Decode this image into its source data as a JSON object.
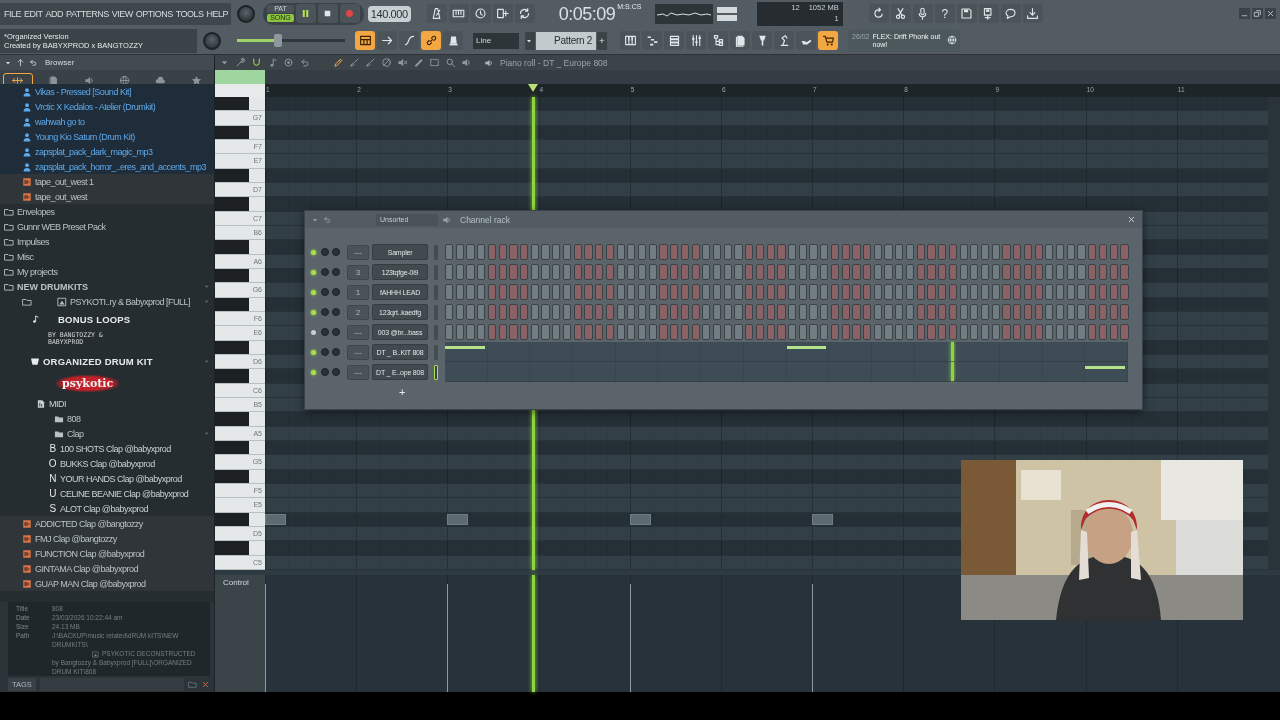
{
  "menu": [
    "FILE",
    "EDIT",
    "ADD",
    "PATTERNS",
    "VIEW",
    "OPTIONS",
    "TOOLS",
    "HELP"
  ],
  "hint_bar": {
    "lines": [
      "*Organized Version",
      "Created by BABYXPROD x BANGTOZZY"
    ]
  },
  "transport": {
    "mode": [
      {
        "label": "PAT",
        "selected": false
      },
      {
        "label": "SONG",
        "selected": true
      }
    ],
    "playing": true,
    "tempo": "140.000"
  },
  "time": {
    "value": "0:05:09",
    "unit": "M:S:CS"
  },
  "master_volume": {
    "level": 0.38
  },
  "cpu_panel": {
    "count": "12",
    "memory": "1052 MB",
    "voices": "1"
  },
  "toolbar_top": [
    {
      "on": false
    },
    {
      "on": false
    },
    {
      "on": false
    },
    {
      "on": false
    },
    {
      "on": false
    }
  ],
  "toolbar_right": [
    {
      "on": false
    },
    {
      "on": false
    },
    {
      "on": false
    },
    {
      "on": false,
      "glyph": "?"
    },
    {
      "on": false
    },
    {
      "on": false
    },
    {
      "on": false
    },
    {
      "on": false
    }
  ],
  "toolbar_second": [
    {
      "on": true
    },
    {
      "on": false
    },
    {
      "on": false
    },
    {
      "on": true
    },
    {
      "on": false
    }
  ],
  "snap": {
    "value": "Line"
  },
  "pattern": {
    "value": "Pattern 2",
    "add": "+"
  },
  "toolbar_windows": [
    {
      "on": false
    },
    {
      "on": false
    },
    {
      "on": false
    },
    {
      "on": false
    },
    {
      "on": false
    },
    {
      "on": false
    },
    {
      "on": false
    },
    {
      "on": false
    },
    {
      "on": false
    },
    {
      "on": true
    }
  ],
  "news": {
    "date": "26/02",
    "text": "FLEX: Drift Phonk out now!"
  },
  "browser": {
    "title": "Browser",
    "tabs": [
      {
        "selected": true
      },
      {
        "selected": false
      },
      {
        "selected": false
      },
      {
        "selected": false
      },
      {
        "selected": false
      },
      {
        "selected": false
      }
    ],
    "tree": [
      {
        "kind": "pack",
        "label": "Vikas - Pressed [Sound Kit]"
      },
      {
        "kind": "pack",
        "label": "Vrctic X Kedalos - Atelier (Drumkit)"
      },
      {
        "kind": "pack",
        "label": "wahwah go to"
      },
      {
        "kind": "pack",
        "label": "Young Kio Saturn (Drum Kit)"
      },
      {
        "kind": "pack",
        "label": "zapsplat_pack_dark_magic_mp3"
      },
      {
        "kind": "pack",
        "label": "zapsplat_pack_horror_..eres_and_accents_mp3"
      },
      {
        "kind": "audio",
        "label": "tape_out_west 1"
      },
      {
        "kind": "audio",
        "label": "tape_out_west"
      },
      {
        "kind": "folder",
        "label": "Envelopes",
        "expanded": false
      },
      {
        "kind": "folder",
        "label": "Gunnr WEB Preset Pack",
        "expanded": false
      },
      {
        "kind": "folder",
        "label": "Impulses",
        "expanded": false
      },
      {
        "kind": "folder",
        "label": "Misc",
        "expanded": false
      },
      {
        "kind": "folder",
        "label": "My projects",
        "expanded": false
      },
      {
        "kind": "folder",
        "label": "NEW DRUMKITS",
        "expanded": true,
        "children": [
          {
            "kind": "pack_folder",
            "label": "PSYKOTI..ry & Babyxprod [FULL]",
            "expanded": true,
            "children": [
              {
                "kind": "banner",
                "label": "BONUS LOOPS",
                "caption": "BY BANGTOZZY & BABYXPROD"
              },
              {
                "kind": "banner",
                "label": "ORGANIZED DRUM KIT",
                "expanded": true,
                "children": [
                  {
                    "kind": "logo",
                    "label": "psykotic"
                  },
                  {
                    "kind": "midi",
                    "label": "MIDI"
                  },
                  {
                    "kind": "folder",
                    "label": "808",
                    "expanded": false
                  },
                  {
                    "kind": "folder",
                    "label": "Clap",
                    "expanded": true,
                    "children": [
                      {
                        "kind": "letter",
                        "mark": "B",
                        "label": "100 SHOTS Clap @babyxprod"
                      },
                      {
                        "kind": "letter",
                        "mark": "O",
                        "label": "BUKKS Clap @babyxprod"
                      },
                      {
                        "kind": "letter",
                        "mark": "N",
                        "label": "YOUR HANDS Clap @babyxprod"
                      },
                      {
                        "kind": "letter",
                        "mark": "U",
                        "label": "CELINE BEANIE Clap @babyxprod"
                      },
                      {
                        "kind": "letter",
                        "mark": "S",
                        "label": "ALOT Clap @babyxprod"
                      },
                      {
                        "kind": "audio",
                        "label": "ADDICTED Clap @bangtozzy"
                      },
                      {
                        "kind": "audio",
                        "label": "FMJ Clap @bangtozzy"
                      },
                      {
                        "kind": "audio",
                        "label": "FUNCTION Clap @babyxprod"
                      },
                      {
                        "kind": "audio",
                        "label": "GINTAMA Clap @babyxprod"
                      },
                      {
                        "kind": "audio",
                        "label": "GUAP MAN Clap @babyxprod"
                      }
                    ]
                  }
                ]
              }
            ]
          }
        ]
      }
    ],
    "info": [
      {
        "label": "Title",
        "value": "808"
      },
      {
        "label": "Date",
        "value": "23/03/2026 10:22:44 am"
      },
      {
        "label": "Size",
        "value": "24.13 MB"
      }
    ],
    "path": {
      "label": "Path",
      "start": "J:\\BACKUP\\music related\\dRUM kITS\\NEW DRUMKITS\\",
      "end": "PSYKOTIC DECONSTRUCTED by Bangtozzy & Babyxprod [FULL]\\ORGANIZED DRUM KIT\\808"
    },
    "tags_label": "TAGS"
  },
  "piano_roll": {
    "title": "Piano roll - DT _ Europe 808",
    "tools": [
      {
        "on": false
      },
      {
        "on": false
      },
      {
        "on": true
      },
      {
        "on": false
      },
      {
        "on": false
      },
      {
        "on": false
      },
      {
        "on": true
      },
      {
        "on": false
      },
      {
        "on": false
      },
      {
        "on": false
      },
      {
        "on": false
      },
      {
        "on": false
      },
      {
        "on": false
      },
      {
        "on": false
      },
      {
        "on": false
      }
    ],
    "ruler": [
      "1",
      "2",
      "3",
      "4",
      "5",
      "6",
      "7",
      "8",
      "9",
      "10",
      "11"
    ],
    "playhead": {
      "level": 0.267
    },
    "keys": [
      {
        "kind": "black"
      },
      {
        "kind": "white",
        "label": "G7"
      },
      {
        "kind": "black"
      },
      {
        "kind": "white",
        "label": "F7"
      },
      {
        "kind": "white",
        "label": "E7"
      },
      {
        "kind": "black"
      },
      {
        "kind": "white",
        "label": "D7"
      },
      {
        "kind": "black"
      },
      {
        "kind": "white",
        "label": "C7"
      },
      {
        "kind": "white",
        "label": "B6"
      },
      {
        "kind": "black"
      },
      {
        "kind": "white",
        "label": "A6"
      },
      {
        "kind": "black"
      },
      {
        "kind": "white",
        "label": "G6"
      },
      {
        "kind": "black"
      },
      {
        "kind": "white",
        "label": "F6"
      },
      {
        "kind": "white",
        "label": "E6"
      },
      {
        "kind": "black"
      },
      {
        "kind": "white",
        "label": "D6"
      },
      {
        "kind": "black"
      },
      {
        "kind": "white",
        "label": "C6"
      },
      {
        "kind": "white",
        "label": "B5"
      },
      {
        "kind": "black"
      },
      {
        "kind": "white",
        "label": "A5"
      },
      {
        "kind": "black"
      },
      {
        "kind": "white",
        "label": "G5"
      },
      {
        "kind": "black"
      },
      {
        "kind": "white",
        "label": "F5"
      },
      {
        "kind": "white",
        "label": "E5"
      },
      {
        "kind": "black",
        "note_in_bar": [
          true,
          false,
          true,
          false,
          true,
          false,
          true,
          false
        ]
      },
      {
        "kind": "white",
        "label": "D5"
      },
      {
        "kind": "black"
      },
      {
        "kind": "white",
        "label": "C5"
      }
    ],
    "control_lane": {
      "label": "Control"
    }
  },
  "channel_rack": {
    "title": "Channel rack",
    "filter": "Unsorted",
    "add": "+",
    "playhead": {
      "level": 0.742
    },
    "channels": [
      {
        "kind": "steps",
        "name": "Sampler",
        "track": "---",
        "on": true,
        "selected": false,
        "steps": [
          false,
          false,
          false,
          false,
          false,
          false,
          false,
          false,
          false,
          false,
          false,
          false,
          false,
          false,
          false,
          false,
          false,
          false,
          false,
          false,
          false,
          false,
          false,
          false,
          false,
          false,
          false,
          false,
          false,
          false,
          false,
          false,
          false,
          false,
          false,
          false,
          false,
          false,
          false,
          false,
          false,
          false,
          false,
          false,
          false,
          false,
          false,
          false,
          false,
          false,
          false,
          false,
          false,
          false,
          false,
          false,
          false,
          false,
          false,
          false,
          false,
          false,
          false,
          false
        ]
      },
      {
        "kind": "steps",
        "name": "123tqfge-0i9",
        "track": "3",
        "on": true,
        "selected": false,
        "steps": [
          false,
          false,
          false,
          false,
          false,
          false,
          false,
          false,
          false,
          false,
          false,
          false,
          false,
          false,
          false,
          false,
          false,
          false,
          false,
          false,
          false,
          false,
          false,
          false,
          false,
          false,
          false,
          false,
          false,
          false,
          false,
          false,
          false,
          false,
          false,
          false,
          false,
          false,
          false,
          false,
          false,
          false,
          false,
          false,
          false,
          false,
          false,
          false,
          false,
          false,
          false,
          false,
          false,
          false,
          false,
          false,
          false,
          false,
          false,
          false,
          false,
          false,
          false,
          false
        ]
      },
      {
        "kind": "steps",
        "name": "fAHHH LEAD",
        "track": "1",
        "on": true,
        "selected": false,
        "steps": [
          false,
          false,
          false,
          false,
          false,
          false,
          false,
          false,
          false,
          false,
          false,
          false,
          false,
          false,
          false,
          false,
          false,
          false,
          false,
          false,
          false,
          false,
          false,
          false,
          false,
          false,
          false,
          false,
          false,
          false,
          false,
          false,
          false,
          false,
          false,
          false,
          false,
          false,
          false,
          false,
          false,
          false,
          false,
          false,
          false,
          false,
          false,
          false,
          false,
          false,
          false,
          false,
          false,
          false,
          false,
          false,
          false,
          false,
          false,
          false,
          false,
          false,
          false,
          false
        ]
      },
      {
        "kind": "steps",
        "name": "123qrt..kaedfg",
        "track": "2",
        "on": true,
        "selected": false,
        "steps": [
          false,
          false,
          false,
          false,
          false,
          false,
          false,
          false,
          false,
          false,
          false,
          false,
          false,
          false,
          false,
          false,
          false,
          false,
          false,
          false,
          false,
          false,
          false,
          false,
          false,
          false,
          false,
          false,
          false,
          false,
          false,
          false,
          false,
          false,
          false,
          false,
          false,
          false,
          false,
          false,
          false,
          false,
          false,
          false,
          false,
          false,
          false,
          false,
          false,
          false,
          false,
          false,
          false,
          false,
          false,
          false,
          false,
          false,
          false,
          false,
          false,
          false,
          false,
          false
        ]
      },
      {
        "kind": "steps",
        "name": "003 @br...bass",
        "track": "---",
        "on": false,
        "selected": false,
        "steps": [
          false,
          false,
          false,
          false,
          false,
          false,
          false,
          false,
          false,
          false,
          false,
          false,
          false,
          false,
          false,
          false,
          false,
          false,
          false,
          false,
          false,
          false,
          false,
          false,
          false,
          false,
          false,
          false,
          false,
          false,
          false,
          false,
          false,
          false,
          false,
          false,
          false,
          false,
          false,
          false,
          false,
          false,
          false,
          false,
          false,
          false,
          false,
          false,
          false,
          false,
          false,
          false,
          false,
          false,
          false,
          false,
          false,
          false,
          false,
          false,
          false,
          false,
          false,
          false
        ]
      },
      {
        "kind": "notes",
        "name": "DT _ B..KIT 808",
        "track": "---",
        "on": true,
        "selected": false,
        "beats": [
          true,
          false,
          false,
          false,
          false,
          false,
          false,
          false,
          true,
          false,
          false,
          false,
          false,
          false,
          false,
          false
        ]
      },
      {
        "kind": "notes",
        "name": "DT _ E..ope 808",
        "track": "---",
        "on": true,
        "selected": true,
        "beats": [
          false,
          false,
          false,
          false,
          false,
          false,
          false,
          false,
          false,
          false,
          false,
          false,
          false,
          false,
          false,
          true
        ]
      }
    ]
  }
}
